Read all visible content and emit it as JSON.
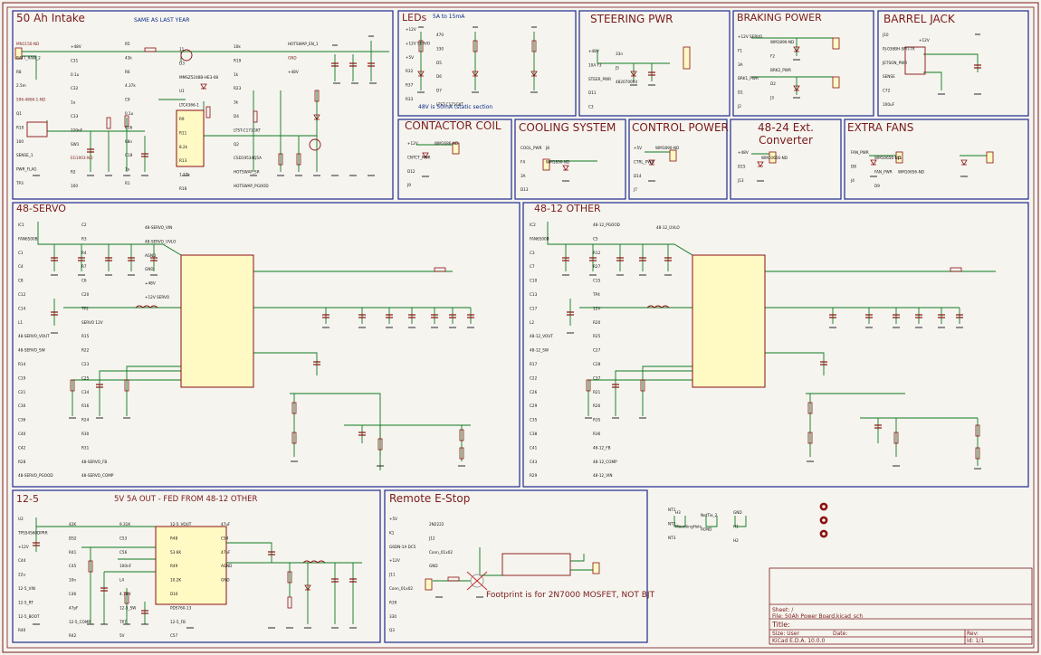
{
  "sections": {
    "intake": "50 Ah Intake",
    "leds": "LEDs",
    "steering": "STEERING PWR",
    "braking": "BRAKING POWER",
    "barrel": "BARREL JACK",
    "contactor": "CONTACTOR COIL",
    "cooling": "COOLING SYSTEM",
    "control": "CONTROL POWER",
    "ext4824": "48-24 Ext. Converter",
    "fans": "EXTRA FANS",
    "servo48": "48-SERVO",
    "other4812": "48-12 OTHER",
    "sec125": "12-5",
    "sec125_note": "5V 5A OUT - FED FROM 48-12 OTHER",
    "estop": "Remote E-Stop"
  },
  "notes": {
    "intake_same": "SAME AS LAST YEAR",
    "leds_range": "5A to 15mA",
    "leds_label": "48V is 50mA (static section",
    "footprint": "Footprint is for 2N7000 MOSFET, NOT BJT"
  },
  "components": {
    "intake": [
      "MN1156-ND",
      "BATT_RAW_2",
      "R8",
      "2.5m",
      "596-4866-1-ND",
      "Q1",
      "R10",
      "100",
      "SENSE_1",
      "PWR_FLAG",
      "TP3",
      "+48V",
      "C31",
      "0.1u",
      "C32",
      "1u",
      "C33",
      "220nF",
      "SW1",
      "EG1903-ND",
      "R2",
      "100",
      "R5",
      "43k",
      "R6",
      "4.37k",
      "C9",
      "0.1u",
      "C16",
      "68n",
      "C18",
      "1u",
      "R1",
      "11",
      "D3",
      "MMSZ5248B-HE3-08",
      "U1",
      "LTC4366-1",
      "R9",
      "R11",
      "8.2k",
      "R13",
      "1.27k",
      "R18",
      "10k",
      "R19",
      "1k",
      "R23",
      "3k",
      "D4",
      "LTST-C171GKT",
      "Q2",
      "CSD19534Q5A",
      "HOTSWAP_SR",
      "HOTSWAP_PGOOD",
      "HOTSWAP_EN_1",
      "GND",
      "+48V"
    ],
    "leds": [
      "+12V",
      "+12V SERVO",
      "+5V",
      "R32",
      "R37",
      "R33",
      "470",
      "330",
      "D5",
      "D6",
      "D7",
      "LTST-C171GKT"
    ],
    "steering": [
      "+48V",
      "10A F3",
      "STEER_PWR",
      "D11",
      "C3",
      "33n",
      "J5",
      "482070004"
    ],
    "braking": [
      "+12V SERVO",
      "F1",
      "3A",
      "BRK1_PWR",
      "D1",
      "J2",
      "WM1890-ND",
      "F2",
      "BRK2_PWR",
      "D2",
      "J3"
    ],
    "barrel": [
      "J10",
      "PJ-036BH-SMT-TR",
      "JETSON_PWR",
      "SENSE",
      "C72",
      "100uF",
      "+12V"
    ],
    "contactor": [
      "+12V",
      "CNTCT_PWR",
      "D12",
      "J9",
      "WM1686-ND"
    ],
    "cooling": [
      "COOL_PWR",
      "F4",
      "3A",
      "D13",
      "J8",
      "WM1890-ND"
    ],
    "control": [
      "+5V",
      "CTRL_PWR",
      "D14",
      "J7",
      "WM1890-ND"
    ],
    "ext": [
      "+48V",
      "D15",
      "J13",
      "WM10656-ND"
    ],
    "fans": [
      "FAN_PWR",
      "D8",
      "J4",
      "WM10656-ND",
      "FAN_PWR",
      "D9",
      "J5",
      "WM10656-ND"
    ],
    "servo48": [
      "IC1",
      "FAN6500B",
      "C1",
      "C4",
      "C8",
      "C12",
      "C14",
      "L1",
      "48-SERVO_VOUT",
      "48-SERVO_SW",
      "R14",
      "C19",
      "C21",
      "C30",
      "C36",
      "C40",
      "C42",
      "R28",
      "48-SERVO_PGOOD",
      "C2",
      "R3",
      "R4",
      "R7",
      "C6",
      "C20",
      "TP2",
      "SERVO 12V",
      "R15",
      "R22",
      "C23",
      "C25",
      "C34",
      "R16",
      "R24",
      "R30",
      "R31",
      "48-SERVO_FB",
      "48-SERVO_COMP",
      "48-SERVO_VIN",
      "48-SERVO_UVLO",
      "AGND",
      "GND",
      "+48V",
      "+12V SERVO"
    ],
    "other4812": [
      "IC2",
      "FAN6500B",
      "C3",
      "C7",
      "C10",
      "C13",
      "C17",
      "L2",
      "48-12_VOUT",
      "48-12_SW",
      "R17",
      "C22",
      "C26",
      "C29",
      "C35",
      "C38",
      "C41",
      "C43",
      "R29",
      "48-12_PGOOD",
      "C5",
      "R12",
      "R27",
      "C15",
      "TP4",
      "12V",
      "R20",
      "R25",
      "C27",
      "C28",
      "C37",
      "R21",
      "R26",
      "R35",
      "R36",
      "48-12_FB",
      "48-12_COMP",
      "48-12_VIN",
      "48-12_UVLO"
    ],
    "sec125": [
      "U2",
      "TPS54560DPRR",
      "+12V",
      "C44",
      "22u",
      "12-5_VIN",
      "12-5_RT",
      "12-5_BOOT",
      "R40",
      "42K",
      "DS2",
      "R41",
      "C45",
      "10n",
      "C46",
      "47pF",
      "12-5_COMP",
      "R42",
      "9.31K",
      "C53",
      "C56",
      "100nF",
      "L4",
      "4.7uH",
      "12-5_SW",
      "TP7",
      "5V",
      "12-5_VOUT",
      "R48",
      "53.6K",
      "R49",
      "10.2K",
      "D16",
      "PDS760-13",
      "12-5_FB",
      "C57",
      "47uF",
      "C54",
      "47uF",
      "AGND",
      "GND"
    ],
    "estop": [
      "+5V",
      "K1",
      "G6DN-1A DC5",
      "+12V",
      "J11",
      "Conn_01x02",
      "R39",
      "330",
      "Q3",
      "2N2222",
      "J12",
      "Conn_01x02",
      "GND"
    ],
    "mounts": [
      "NT1",
      "NT2",
      "NT3",
      "NetTie_2",
      "AGND",
      "GND",
      "H1",
      "H2",
      "H3",
      "MountingHole"
    ]
  },
  "title_block": {
    "sheet": "Sheet: /",
    "file": "File: 50Ah Power Board.kicad_sch",
    "title": "Title:",
    "size": "Size: User",
    "date": "Date:",
    "rev": "Rev:",
    "tool": "KiCad E.D.A. 10.0.0",
    "id": "Id: 1/1"
  },
  "colors": {
    "background": "#f5f4ef",
    "border": "#7a1a1a",
    "wire": "#0f7a1f",
    "section_box": "#1f2a8c",
    "symbol": "#8b1010",
    "symbol_fill": "#fff9c4",
    "label": "#111111",
    "blue_text": "#0b2a8a"
  }
}
